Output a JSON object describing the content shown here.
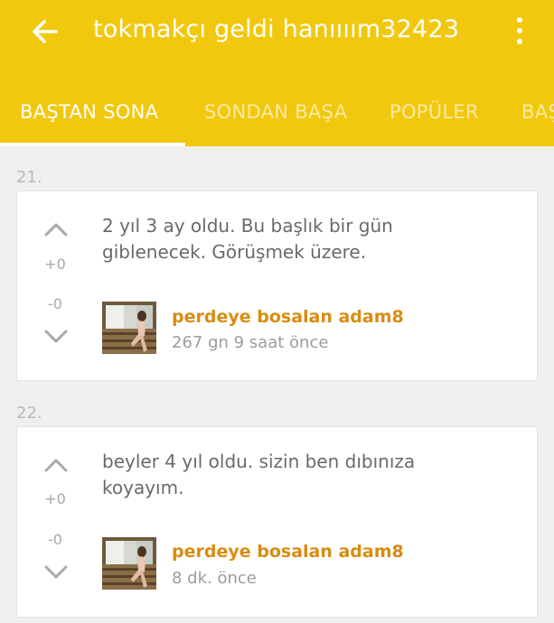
{
  "header": {
    "title": "tokmakçı geldi hanıııım32423",
    "back_icon": "arrow-left-icon",
    "menu_icon": "more-vertical-icon"
  },
  "tabs": [
    {
      "label": "BAŞTAN SONA",
      "active": true
    },
    {
      "label": "SONDAN BAŞA",
      "active": false
    },
    {
      "label": "POPÜLER",
      "active": false
    },
    {
      "label": "BAŞ",
      "active": false
    }
  ],
  "entries": [
    {
      "number": "21.",
      "text": "2 yıl 3 ay oldu. Bu başlık bir gün giblenecek. Görüşmek üzere.",
      "upvotes": "+0",
      "downvotes": "-0",
      "author": "perdeye bosalan adam8",
      "time": "267 gn 9 saat  önce"
    },
    {
      "number": "22.",
      "text": "beyler 4 yıl oldu. sizin ben dıbınıza koyayım.",
      "upvotes": "+0",
      "downvotes": "-0",
      "author": "perdeye bosalan adam8",
      "time": "8 dk. önce"
    }
  ],
  "colors": {
    "appbar": "#f2c80e",
    "author": "#d98c11",
    "background": "#f0efed"
  }
}
